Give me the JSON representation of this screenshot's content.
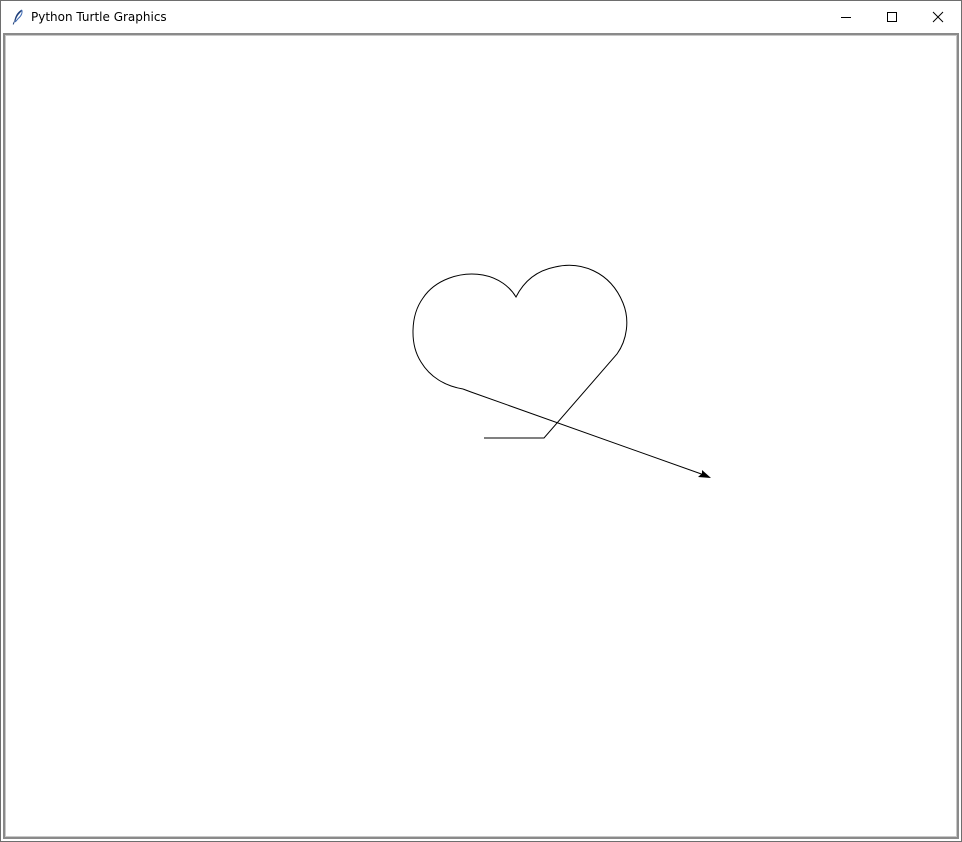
{
  "window": {
    "title": "Python Turtle Graphics",
    "icon": "feather-icon"
  },
  "controls": {
    "minimize_icon": "minimize-icon",
    "maximize_icon": "maximize-icon",
    "close_icon": "close-icon"
  },
  "canvas": {
    "background": "#ffffff",
    "pen_color": "#000000",
    "turtle_shape": "classic-arrow"
  }
}
